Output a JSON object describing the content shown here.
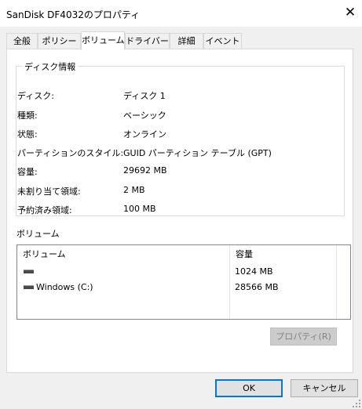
{
  "window": {
    "title": "SanDisk DF4032のプロパティ"
  },
  "tabs": [
    {
      "label": "全般"
    },
    {
      "label": "ポリシー"
    },
    {
      "label": "ボリューム"
    },
    {
      "label": "ドライバー"
    },
    {
      "label": "詳細"
    },
    {
      "label": "イベント"
    }
  ],
  "active_tab": "ボリューム",
  "disk_info": {
    "group_title": "ディスク情報",
    "rows": [
      {
        "label": "ディスク:",
        "value": "ディスク 1"
      },
      {
        "label": "種類:",
        "value": "ベーシック"
      },
      {
        "label": "状態:",
        "value": "オンライン"
      },
      {
        "label": "パーティションのスタイル:",
        "value": "GUID パーティション テーブル (GPT)"
      },
      {
        "label": "容量:",
        "value": "29692 MB"
      },
      {
        "label": "未割り当て領域:",
        "value": "2 MB"
      },
      {
        "label": "予約済み領域:",
        "value": "100 MB"
      }
    ]
  },
  "volumes": {
    "section_title": "ボリューム",
    "columns": {
      "volume": "ボリューム",
      "capacity": "容量"
    },
    "rows": [
      {
        "name": "",
        "capacity": "1024 MB",
        "icon": "drive-icon"
      },
      {
        "name": "Windows (C:)",
        "capacity": "28566 MB",
        "icon": "drive-icon"
      }
    ],
    "properties_button": "プロパティ(R)"
  },
  "buttons": {
    "ok": "OK",
    "cancel": "キャンセル"
  }
}
